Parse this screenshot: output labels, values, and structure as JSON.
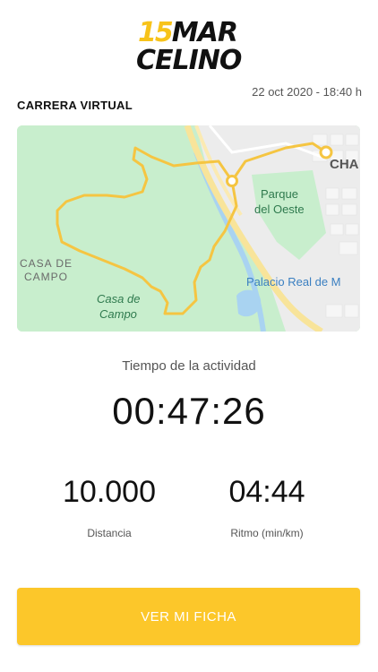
{
  "brand": {
    "logo_number": "15",
    "logo_line1": "MAR",
    "logo_line2": "CELINO"
  },
  "activity": {
    "timestamp": "22 oct 2020 - 18:40 h",
    "event_type": "CARRERA VIRTUAL"
  },
  "map": {
    "label_chamberi": "CHA",
    "label_parque_line1": "Parque",
    "label_parque_line2": "del Oeste",
    "label_casa_upper_line1": "CASA DE",
    "label_casa_upper_line2": "CAMPO",
    "label_casa_italic_line1": "Casa de",
    "label_casa_italic_line2": "Campo",
    "label_palacio": "Palacio Real de M"
  },
  "stats": {
    "duration_label": "Tiempo de la actividad",
    "duration_value": "00:47:26",
    "distance_value": "10.000",
    "distance_label": "Distancia",
    "pace_value": "04:44",
    "pace_label": "Ritmo (min/km)"
  },
  "actions": {
    "view_sheet_label": "VER MI FICHA"
  },
  "colors": {
    "brand_yellow": "#fcc72a",
    "route": "#f5c542"
  }
}
